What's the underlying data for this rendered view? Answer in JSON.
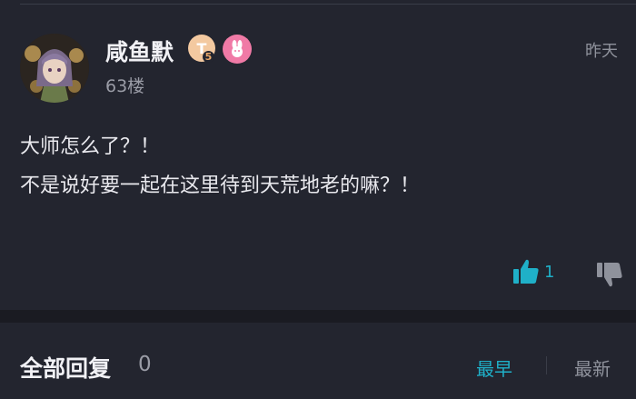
{
  "post": {
    "username": "咸鱼默",
    "badge_level_letter": "T",
    "badge_level_number": "5",
    "floor": "63楼",
    "time": "昨天",
    "content_lines": [
      "大师怎么了？！",
      "不是说好要一起在这里待到天荒地老的嘛？！"
    ],
    "likes": "1"
  },
  "replies": {
    "title": "全部回复",
    "count": "0",
    "sort_earliest": "最早",
    "sort_latest": "最新"
  },
  "colors": {
    "accent": "#1fb0c8",
    "background": "#23252f",
    "muted": "#8f929c"
  },
  "icons": {
    "like": "thumbs-up-icon",
    "dislike": "thumbs-down-icon",
    "pink_badge": "bunny-badge-icon"
  }
}
